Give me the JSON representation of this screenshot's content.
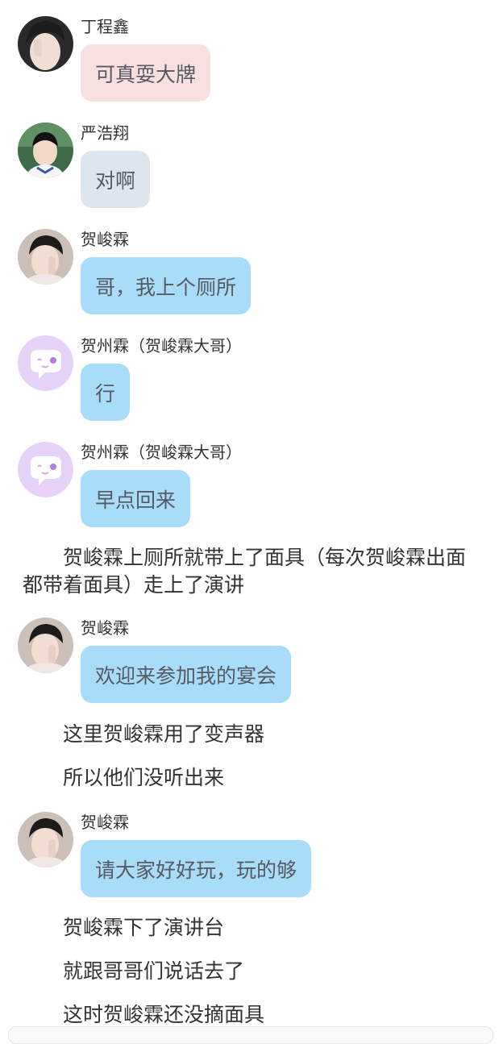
{
  "messages": [
    {
      "name": "丁程鑫",
      "text": "可真耍大牌",
      "bubble_color": "#f8e0e0"
    },
    {
      "name": "严浩翔",
      "text": "对啊",
      "bubble_color": "#dde5ee"
    },
    {
      "name": "贺峻霖",
      "text": "哥，我上个厕所",
      "bubble_color": "#a8dcf8"
    },
    {
      "name": "贺州霖（贺峻霖大哥）",
      "text": "行",
      "bubble_color": "#a8dcf8"
    },
    {
      "name": "贺州霖（贺峻霖大哥）",
      "text": "早点回来",
      "bubble_color": "#a8dcf8"
    },
    {
      "name": "贺峻霖",
      "text": "欢迎来参加我的宴会",
      "bubble_color": "#a8dcf8"
    },
    {
      "name": "贺峻霖",
      "text": "请大家好好玩，玩的够",
      "bubble_color": "#a8dcf8"
    }
  ],
  "narration": [
    "贺峻霖上厕所就带上了面具（每次贺峻霖出面都带着面具）走上了演讲",
    "这里贺峻霖用了变声器",
    "所以他们没听出来",
    "贺峻霖下了演讲台",
    "就跟哥哥们说话去了",
    "这时贺峻霖还没摘面具"
  ]
}
